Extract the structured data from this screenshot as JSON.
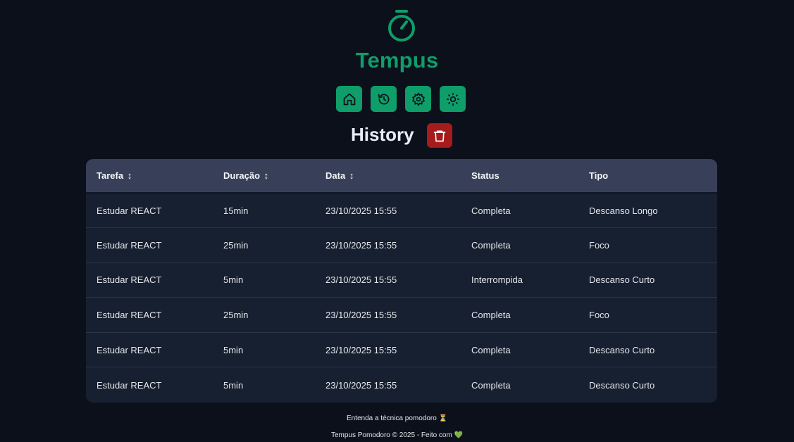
{
  "app": {
    "title": "Tempus",
    "accent": "#0f9d6a",
    "danger": "#a61b1b"
  },
  "nav": [
    {
      "name": "home",
      "icon": "home-icon"
    },
    {
      "name": "history",
      "icon": "history-icon"
    },
    {
      "name": "settings",
      "icon": "gear-icon"
    },
    {
      "name": "theme",
      "icon": "sun-icon"
    }
  ],
  "page": {
    "title": "History",
    "clear_icon": "trash-icon"
  },
  "table": {
    "headers": [
      "Tarefa",
      "Duração",
      "Data",
      "Status",
      "Tipo"
    ],
    "sort_glyph": "↕",
    "rows": [
      [
        "Estudar REACT",
        "15min",
        "23/10/2025 15:55",
        "Completa",
        "Descanso Longo"
      ],
      [
        "Estudar REACT",
        "25min",
        "23/10/2025 15:55",
        "Completa",
        "Foco"
      ],
      [
        "Estudar REACT",
        "5min",
        "23/10/2025 15:55",
        "Interrompida",
        "Descanso Curto"
      ],
      [
        "Estudar REACT",
        "25min",
        "23/10/2025 15:55",
        "Completa",
        "Foco"
      ],
      [
        "Estudar REACT",
        "5min",
        "23/10/2025 15:55",
        "Completa",
        "Descanso Curto"
      ],
      [
        "Estudar REACT",
        "5min",
        "23/10/2025 15:55",
        "Completa",
        "Descanso Curto"
      ]
    ]
  },
  "footer": {
    "link": "Entenda a técnica pomodoro",
    "link_icon": "⏳",
    "copyright": "Tempus Pomodoro © 2025 - Feito com",
    "heart": "💚"
  }
}
